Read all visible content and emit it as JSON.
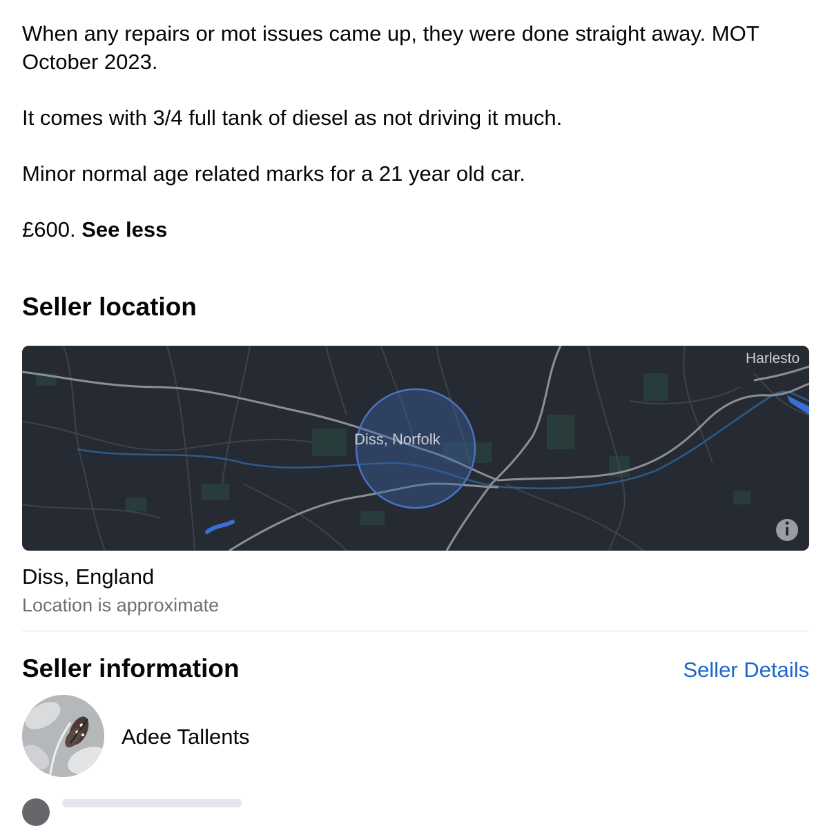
{
  "description": {
    "paragraphs": [
      "When any repairs or mot issues came up, they were done straight away. MOT October 2023.",
      "It comes with 3/4 full tank of diesel as not driving it much.",
      "Minor normal age related marks for a 21 year old car."
    ],
    "price_text": "£600.",
    "see_less_label": "See less"
  },
  "seller_location": {
    "heading": "Seller location",
    "map": {
      "area_label": "Diss, Norfolk",
      "town_label": "Harlesto",
      "info_icon": "info-icon",
      "background_color": "#262b33",
      "radius_color": "#3c5fa3"
    },
    "city": "Diss, England",
    "note": "Location is approximate"
  },
  "seller_information": {
    "heading": "Seller information",
    "details_link": "Seller Details",
    "name": "Adee Tallents",
    "avatar_icon": "butterfly-avatar"
  },
  "colors": {
    "link": "#1b66c9",
    "secondary_text": "#6d6f73",
    "divider": "#dadde1"
  }
}
